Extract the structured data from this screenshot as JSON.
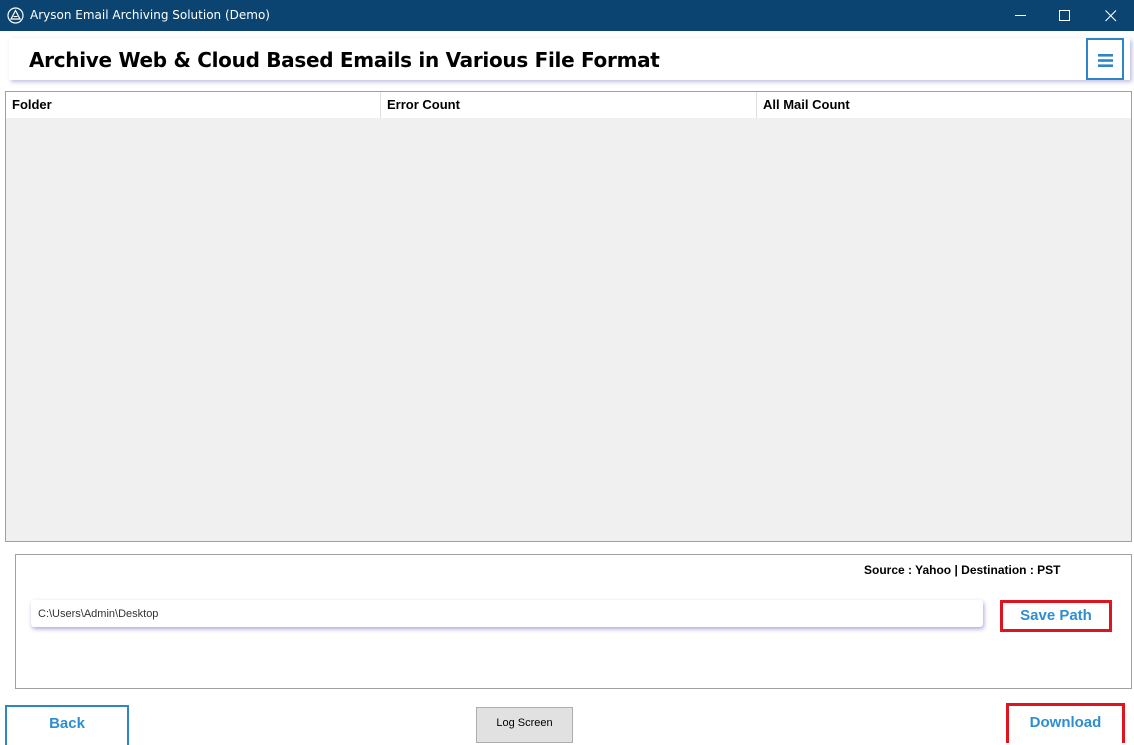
{
  "window": {
    "title": "Aryson Email Archiving Solution (Demo)",
    "app_icon": "aryson-logo-icon",
    "controls": [
      "minimize-icon",
      "maximize-icon",
      "close-icon"
    ]
  },
  "header": {
    "title": "Archive Web & Cloud Based Emails in Various File Format",
    "menu_icon": "hamburger-menu-icon"
  },
  "table": {
    "columns": [
      "Folder",
      "Error Count",
      "All Mail Count"
    ],
    "rows": []
  },
  "path_panel": {
    "source_destination": "Source : Yahoo | Destination : PST",
    "path_value": "C:\\Users\\Admin\\Desktop",
    "save_path_label": "Save Path"
  },
  "footer": {
    "back_label": "Back",
    "log_screen_label": "Log Screen",
    "download_label": "Download"
  },
  "colors": {
    "titlebar": "#0b4470",
    "accent_blue": "#2e8ed0",
    "highlight_red": "#e0141e",
    "grid_background": "#f0f0f0"
  }
}
